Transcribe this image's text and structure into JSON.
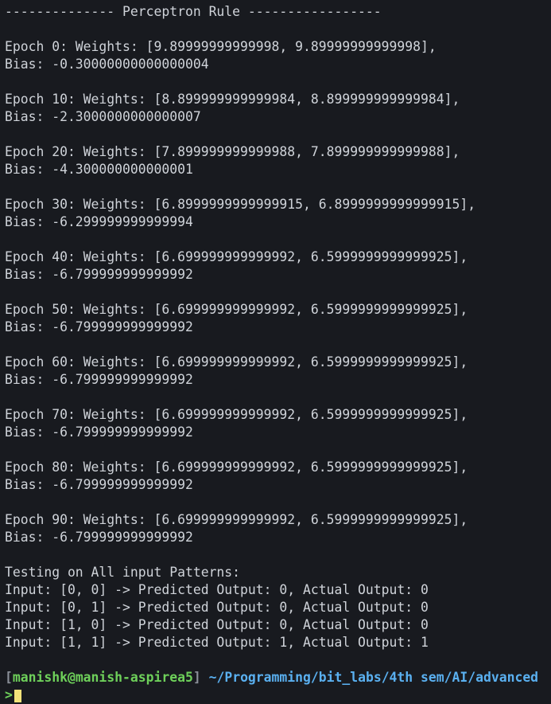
{
  "terminal": {
    "lines": [
      "-------------- Perceptron Rule -----------------",
      "",
      "Epoch 0: Weights: [9.89999999999998, 9.89999999999998],",
      "Bias: -0.30000000000000004",
      "",
      "Epoch 10: Weights: [8.899999999999984, 8.899999999999984],",
      "Bias: -2.3000000000000007",
      "",
      "Epoch 20: Weights: [7.899999999999988, 7.899999999999988],",
      "Bias: -4.300000000000001",
      "",
      "Epoch 30: Weights: [6.8999999999999915, 6.8999999999999915],",
      "Bias: -6.299999999999994",
      "",
      "Epoch 40: Weights: [6.699999999999992, 6.5999999999999925],",
      "Bias: -6.799999999999992",
      "",
      "Epoch 50: Weights: [6.699999999999992, 6.5999999999999925],",
      "Bias: -6.799999999999992",
      "",
      "Epoch 60: Weights: [6.699999999999992, 6.5999999999999925],",
      "Bias: -6.799999999999992",
      "",
      "Epoch 70: Weights: [6.699999999999992, 6.5999999999999925],",
      "Bias: -6.799999999999992",
      "",
      "Epoch 80: Weights: [6.699999999999992, 6.5999999999999925],",
      "Bias: -6.799999999999992",
      "",
      "Epoch 90: Weights: [6.699999999999992, 6.5999999999999925],",
      "Bias: -6.799999999999992",
      "",
      "Testing on All input Patterns:",
      "Input: [0, 0] -> Predicted Output: 0, Actual Output: 0",
      "Input: [0, 1] -> Predicted Output: 0, Actual Output: 0",
      "Input: [1, 0] -> Predicted Output: 0, Actual Output: 0",
      "Input: [1, 1] -> Predicted Output: 1, Actual Output: 1",
      ""
    ],
    "prompt": {
      "open_bracket": "[",
      "user_host": "manishk@manish-aspirea5",
      "close_bracket": "]",
      "path": "~/Programming/bit_labs/4th sem/AI/advanced"
    },
    "caret": ">",
    "colors": {
      "background": "#181a1f",
      "text": "#cfd3d9",
      "user": "#6ed05a",
      "path": "#5ab0f0",
      "cursor": "#f2e27a"
    }
  }
}
